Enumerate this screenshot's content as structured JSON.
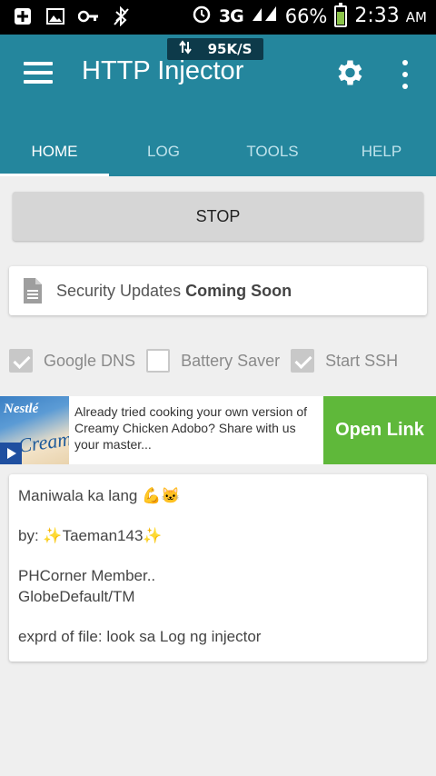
{
  "status_bar": {
    "network": "3G",
    "battery_percent": "66%",
    "battery_level": 0.66,
    "time": "2:33",
    "ampm": "AM"
  },
  "speed": {
    "value": "95K/S"
  },
  "app": {
    "title": "HTTP Injector"
  },
  "tabs": [
    {
      "label": "HOME",
      "active": true
    },
    {
      "label": "LOG",
      "active": false
    },
    {
      "label": "TOOLS",
      "active": false
    },
    {
      "label": "HELP",
      "active": false
    }
  ],
  "stop_button": {
    "label": "STOP"
  },
  "security": {
    "prefix": "Security Updates ",
    "emphasis": "Coming Soon"
  },
  "options": [
    {
      "label": "Google DNS",
      "checked": true
    },
    {
      "label": "Battery Saver",
      "checked": false
    },
    {
      "label": "Start SSH",
      "checked": true
    }
  ],
  "ad": {
    "brand": "Nestlé",
    "product": "Cream",
    "text": "Already tried cooking your own version of Creamy Chicken Adobo? Share with us your master...",
    "cta": "Open Link"
  },
  "message": {
    "line1": "Maniwala ka lang 💪🐱",
    "line2": "by: ✨Taeman143✨",
    "line3": "PHCorner Member..",
    "line4": "GlobeDefault/TM",
    "line5": "exprd of file: look sa Log ng injector"
  },
  "colors": {
    "appbar": "#24869d",
    "speed_badge": "#0d3a4a",
    "cta": "#5fb83a"
  }
}
